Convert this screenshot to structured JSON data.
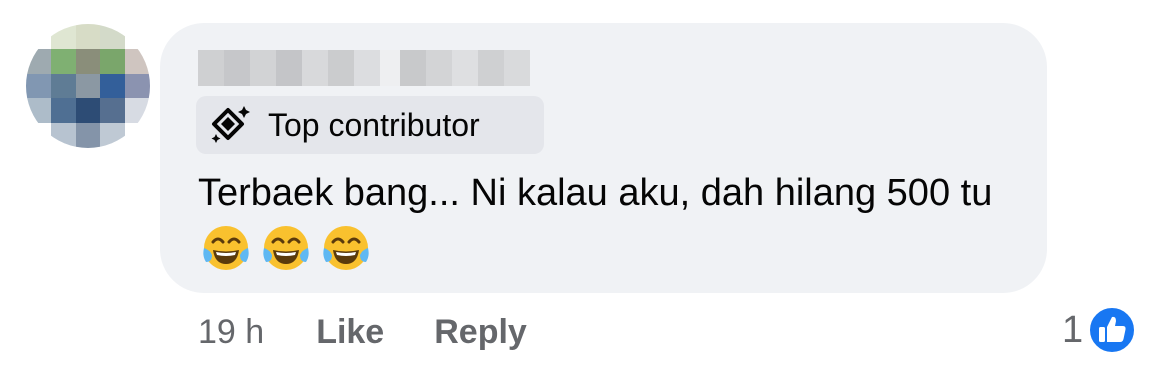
{
  "comment": {
    "badge_label": "Top contributor",
    "text": "Terbaek bang... Ni kalau aku, dah hilang 500 tu",
    "emojis": [
      "😂",
      "😂",
      "😂"
    ]
  },
  "actions": {
    "time": "19 h",
    "like_label": "Like",
    "reply_label": "Reply"
  },
  "reactions": {
    "count": "1",
    "icon": "like-thumbs-up-icon",
    "color": "#1877f2"
  },
  "colors": {
    "bubble": "#f0f2f5",
    "badge": "#e4e6eb",
    "text": "#050505",
    "secondary": "#65676b"
  },
  "icons": {
    "avatar": "pixelated-avatar",
    "name": "pixelated-name",
    "badge": "diamond-sparkle-icon"
  }
}
